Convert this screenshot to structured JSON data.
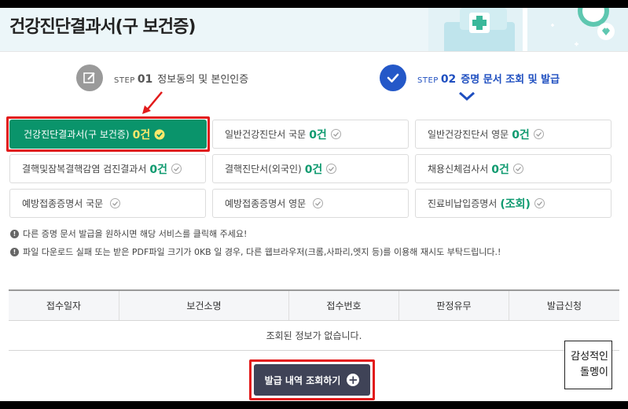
{
  "page": {
    "title": "건강진단결과서(구 보건증)"
  },
  "steps": [
    {
      "word": "STEP",
      "num": "01",
      "label": "정보동의 및 본인인증",
      "icon": "pencil-edit-icon"
    },
    {
      "word": "STEP",
      "num": "02",
      "label": "증명 문서 조회 및 발급",
      "icon": "check-icon"
    }
  ],
  "documents": [
    {
      "name": "건강진단결과서(구 보건증)",
      "count": "0건",
      "selected": true
    },
    {
      "name": "일반건강진단서 국문",
      "count": "0건"
    },
    {
      "name": "일반건강진단서 영문",
      "count": "0건"
    },
    {
      "name": "결핵및잠복결핵감염 검진결과서",
      "count": "0건"
    },
    {
      "name": "결핵진단서(외국인)",
      "count": "0건"
    },
    {
      "name": "채용신체검사서",
      "count": "0건"
    },
    {
      "name": "예방접종증명서 국문",
      "count": ""
    },
    {
      "name": "예방접종증명서 영문",
      "count": ""
    },
    {
      "name": "진료비납입증명서",
      "count": "(조회)"
    }
  ],
  "notices": [
    "다른 증명 문서 발급을 원하시면 해당 서비스를 클릭해 주세요!",
    "파일 다운로드 실패 또는 받은 PDF파일 크기가 0KB 일 경우, 다른 웹브라우저(크롬,사파리,엣지 등)를 이용해 재시도 부탁드립니다.!"
  ],
  "table": {
    "columns": [
      "접수일자",
      "보건소명",
      "접수번호",
      "판정유무",
      "발급신청"
    ],
    "empty_message": "조회된 정보가 없습니다."
  },
  "query_button": {
    "label": "발급 내역 조회하기",
    "icon": "plus-circle-icon"
  },
  "watermark": {
    "line1": "감성적인",
    "line2": "돌멩이"
  },
  "colors": {
    "primary_green": "#0a946b",
    "step_blue": "#2458c8",
    "highlight_red": "#e21b1b",
    "count_yellow": "#ffe86b",
    "button_dark": "#3f4357"
  }
}
